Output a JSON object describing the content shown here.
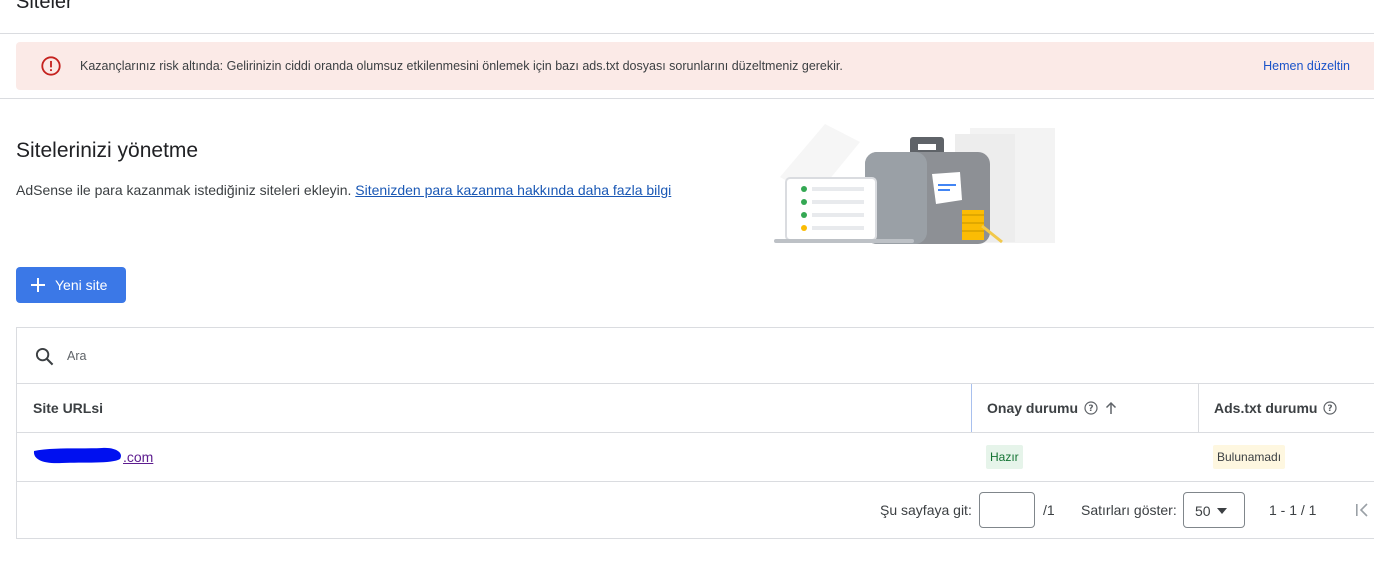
{
  "header": {
    "title": "Siteler"
  },
  "alert": {
    "message": "Kazançlarınız risk altında: Gelirinizin ciddi oranda olumsuz etkilenmesini önlemek için bazı ads.txt dosyası sorunlarını düzeltmeniz gerekir.",
    "action_label": "Hemen düzeltin",
    "icon": "error-outline-icon",
    "color": "#c5221f"
  },
  "intro": {
    "heading": "Sitelerinizi yönetme",
    "description": "AdSense ile para kazanmak istediğiniz siteleri ekleyin.",
    "link_text": "Sitenizden para kazanma hakkında daha fazla bilgi"
  },
  "new_site_button": {
    "label": "Yeni site",
    "icon": "plus-icon",
    "color": "#3b78e7"
  },
  "search": {
    "placeholder": "Ara",
    "value": ""
  },
  "table": {
    "columns": [
      "Site URLsi",
      "Onay durumu",
      "Ads.txt durumu"
    ],
    "rows": [
      {
        "site_url": ".com",
        "approval_status": "Hazır",
        "ads_txt_status": "Bulunamadı"
      }
    ]
  },
  "pagination": {
    "goto_label": "Şu sayfaya git:",
    "page_value": "",
    "total_pages": "/1",
    "rows_label": "Satırları göster:",
    "rows_per_page": "50",
    "range": "1 - 1 / 1"
  }
}
